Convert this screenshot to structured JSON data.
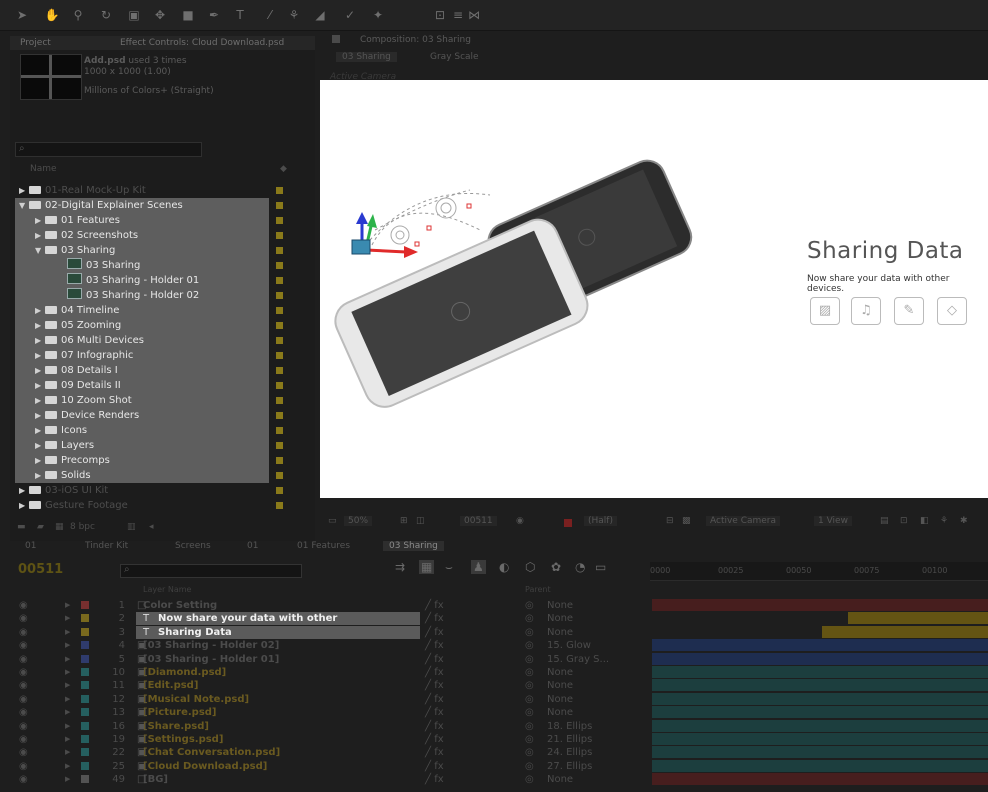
{
  "project": {
    "tabs": [
      "Project",
      "Effect Controls: Cloud Download.psd"
    ],
    "selected_item": {
      "name": "Add.psd",
      "used": "used 3 times",
      "size": "1000 x 1000 (1.00)",
      "alpha": "Millions of Colors+ (Straight)"
    },
    "column_header": "Name",
    "tree": [
      {
        "label": "01-Real Mock-Up Kit",
        "depth": 0,
        "type": "folder",
        "open": false,
        "selected": false
      },
      {
        "label": "02-Digital Explainer Scenes",
        "depth": 0,
        "type": "folder",
        "open": true,
        "selected": true
      },
      {
        "label": "01 Features",
        "depth": 1,
        "type": "folder",
        "open": false,
        "selected": true
      },
      {
        "label": "02 Screenshots",
        "depth": 1,
        "type": "folder",
        "open": false,
        "selected": true
      },
      {
        "label": "03 Sharing",
        "depth": 1,
        "type": "folder",
        "open": true,
        "selected": true
      },
      {
        "label": "03 Sharing",
        "depth": 2,
        "type": "comp",
        "selected": true
      },
      {
        "label": "03 Sharing - Holder 01",
        "depth": 2,
        "type": "comp",
        "selected": true
      },
      {
        "label": "03 Sharing - Holder 02",
        "depth": 2,
        "type": "comp",
        "selected": true
      },
      {
        "label": "04 Timeline",
        "depth": 1,
        "type": "folder",
        "open": false,
        "selected": true
      },
      {
        "label": "05 Zooming",
        "depth": 1,
        "type": "folder",
        "open": false,
        "selected": true
      },
      {
        "label": "06 Multi Devices",
        "depth": 1,
        "type": "folder",
        "open": false,
        "selected": true
      },
      {
        "label": "07 Infographic",
        "depth": 1,
        "type": "folder",
        "open": false,
        "selected": true
      },
      {
        "label": "08 Details I",
        "depth": 1,
        "type": "folder",
        "open": false,
        "selected": true
      },
      {
        "label": "09 Details II",
        "depth": 1,
        "type": "folder",
        "open": false,
        "selected": true
      },
      {
        "label": "10 Zoom Shot",
        "depth": 1,
        "type": "folder",
        "open": false,
        "selected": true
      },
      {
        "label": "Device Renders",
        "depth": 1,
        "type": "folder",
        "open": false,
        "selected": true
      },
      {
        "label": "Icons",
        "depth": 1,
        "type": "folder",
        "open": false,
        "selected": true
      },
      {
        "label": "Layers",
        "depth": 1,
        "type": "folder",
        "open": false,
        "selected": true
      },
      {
        "label": "Precomps",
        "depth": 1,
        "type": "folder",
        "open": false,
        "selected": true
      },
      {
        "label": "Solids",
        "depth": 1,
        "type": "folder",
        "open": false,
        "selected": true
      },
      {
        "label": "03-iOS UI Kit",
        "depth": 0,
        "type": "folder",
        "open": false,
        "selected": false
      },
      {
        "label": "Gesture Footage",
        "depth": 0,
        "type": "folder",
        "open": false,
        "selected": false
      }
    ],
    "footer_bpc": "8 bpc"
  },
  "composition": {
    "tab_title": "Composition: 03 Sharing",
    "sub_tab": "03 Sharing",
    "guide": "Gray Scale",
    "view_label": "Active Camera",
    "heading": "Sharing Data",
    "subheading": "Now share your data with other devices.",
    "icons": [
      "image-icon",
      "music-note-icon",
      "pencil-icon",
      "diamond-icon"
    ],
    "viewer_controls": {
      "zoom": "50%",
      "timecode": "00511",
      "resolution": "(Half)",
      "camera": "Active Camera",
      "views": "1 View"
    }
  },
  "timeline": {
    "tabs": [
      "01",
      "Tinder Kit",
      "Screens",
      "01",
      "01 Features",
      "03 Sharing"
    ],
    "active_tab": "03 Sharing",
    "timecode": "00511",
    "ruler_ticks": [
      "0000",
      "00025",
      "00050",
      "00075",
      "00100"
    ],
    "layer_header": "Layer Name",
    "parent_header": "Parent",
    "layers": [
      {
        "num": "1",
        "name": "Color Setting",
        "type": "solid",
        "label_color": "#b23b3b",
        "parent": "None",
        "selected": false
      },
      {
        "num": "2",
        "name": "Now share your data with other",
        "type": "text",
        "label_color": "#b59b1e",
        "parent": "None",
        "selected": true
      },
      {
        "num": "3",
        "name": "Sharing Data",
        "type": "text",
        "label_color": "#b59b1e",
        "parent": "None",
        "selected": true
      },
      {
        "num": "4",
        "name": "[03 Sharing - Holder 02]",
        "type": "comp",
        "label_color": "#3a4fa0",
        "parent": "15. Glow",
        "selected": false
      },
      {
        "num": "5",
        "name": "[03 Sharing - Holder 01]",
        "type": "comp",
        "label_color": "#3a4fa0",
        "parent": "15. Gray S...",
        "selected": false
      },
      {
        "num": "10",
        "name": "[Diamond.psd]",
        "type": "psd",
        "label_color": "#2a8a8a",
        "parent": "None",
        "selected": false
      },
      {
        "num": "11",
        "name": "[Edit.psd]",
        "type": "psd",
        "label_color": "#2a8a8a",
        "parent": "None",
        "selected": false
      },
      {
        "num": "12",
        "name": "[Musical Note.psd]",
        "type": "psd",
        "label_color": "#2a8a8a",
        "parent": "None",
        "selected": false
      },
      {
        "num": "13",
        "name": "[Picture.psd]",
        "type": "psd",
        "label_color": "#2a8a8a",
        "parent": "None",
        "selected": false
      },
      {
        "num": "16",
        "name": "[Share.psd]",
        "type": "psd",
        "label_color": "#2a8a8a",
        "parent": "18. Ellips",
        "selected": false
      },
      {
        "num": "19",
        "name": "[Settings.psd]",
        "type": "psd",
        "label_color": "#2a8a8a",
        "parent": "21. Ellips",
        "selected": false
      },
      {
        "num": "22",
        "name": "[Chat Conversation.psd]",
        "type": "psd",
        "label_color": "#2a8a8a",
        "parent": "24. Ellips",
        "selected": false
      },
      {
        "num": "25",
        "name": "[Cloud Download.psd]",
        "type": "psd",
        "label_color": "#2a8a8a",
        "parent": "27. Ellips",
        "selected": false
      },
      {
        "num": "49",
        "name": "[BG]",
        "type": "solid",
        "label_color": "#777777",
        "parent": "None",
        "selected": false
      }
    ]
  }
}
